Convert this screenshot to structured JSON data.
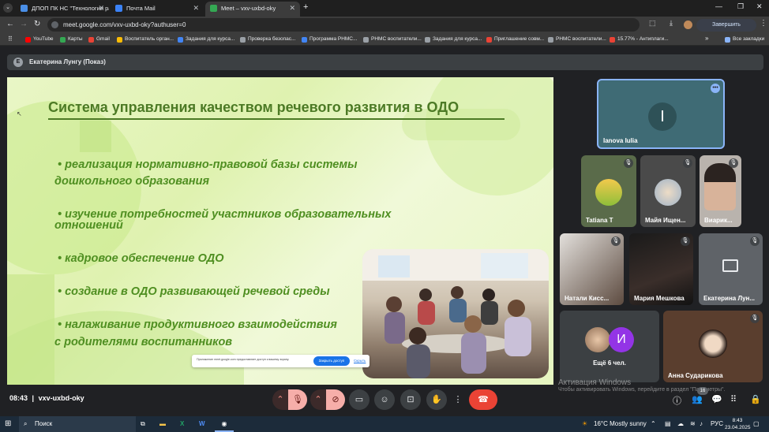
{
  "browser": {
    "tabs": [
      {
        "label": "ДПОП ПК НС \"Технологии ра",
        "color": "#4a8fe7"
      },
      {
        "label": "Почта Mail",
        "color": "#3b82f6"
      },
      {
        "label": "Meet – vxv-uxbd-oky",
        "color": "#34a853"
      }
    ],
    "url": "meet.google.com/vxv-uxbd-oky?authuser=0",
    "update_button": "Завершить обновление",
    "bookmarks": [
      {
        "label": "YouTube",
        "color": "#ff0000"
      },
      {
        "label": "Карты",
        "color": "#34a853"
      },
      {
        "label": "Gmail",
        "color": "#ea4335"
      },
      {
        "label": "Воспитатель орган...",
        "color": "#fbbc05"
      },
      {
        "label": "Задания для курса...",
        "color": "#4285f4"
      },
      {
        "label": "Проверка безопас...",
        "color": "#9aa0a6"
      },
      {
        "label": "Программа РНМС...",
        "color": "#4285f4"
      },
      {
        "label": "РНМС воспитатели...",
        "color": "#9aa0a6"
      },
      {
        "label": "Задания для курса...",
        "color": "#9aa0a6"
      },
      {
        "label": "Приглашение совм...",
        "color": "#ea4335"
      },
      {
        "label": "РНМС воспитатели...",
        "color": "#9aa0a6"
      },
      {
        "label": "15.77% - Антиплаги...",
        "color": "#ea4335"
      }
    ],
    "all_bookmarks": "Все закладки"
  },
  "meet": {
    "presenter": "Екатерина Лунгу (Показ)",
    "slide": {
      "title": "Система управления качеством речевого развития в ОДО",
      "bullets": [
        {
          "line1": "• реализация нормативно-правовой базы системы",
          "line2": "дошкольного образования"
        },
        {
          "line1": "• изучение потребностей участников образовательных",
          "line2": "отношений"
        },
        {
          "line1": "• кадровое обеспечение ОДО",
          "line2": ""
        },
        {
          "line1": "• создание в ОДО развивающей речевой среды",
          "line2": ""
        },
        {
          "line1": "• налаживание продуктивного взаимодействия",
          "line2": "с родителями воспитанников"
        }
      ],
      "notice_text": "Приложение meet.google.com предоставляет доступ к вашему экрану.",
      "notice_button": "Закрыть доступ",
      "notice_hide": "Скрыть"
    },
    "participants": [
      {
        "name": "Ianova Iulia",
        "initial": "I",
        "speaking": true
      },
      {
        "name": "Tatiana T"
      },
      {
        "name": "Майя Ищен..."
      },
      {
        "name": "Виарик..."
      },
      {
        "name": "Натали Кисс..."
      },
      {
        "name": "Мария Мешкова"
      },
      {
        "name": "Екатерина Лун..."
      },
      {
        "name": "Ещё 6 чел.",
        "initial": "И"
      },
      {
        "name": "Анна Сударикова"
      }
    ],
    "watermark_line1": "Активация Windows",
    "watermark_line2": "Чтобы активировать Windows, перейдите в раздел \"Параметры\".",
    "time": "08:43",
    "meeting_code": "vxv-uxbd-oky",
    "people_count": "16"
  },
  "taskbar": {
    "search": "Поиск",
    "weather": "16°C  Mostly sunny",
    "lang": "РУС",
    "clock_time": "8:43",
    "clock_date": "23.04.2025"
  }
}
